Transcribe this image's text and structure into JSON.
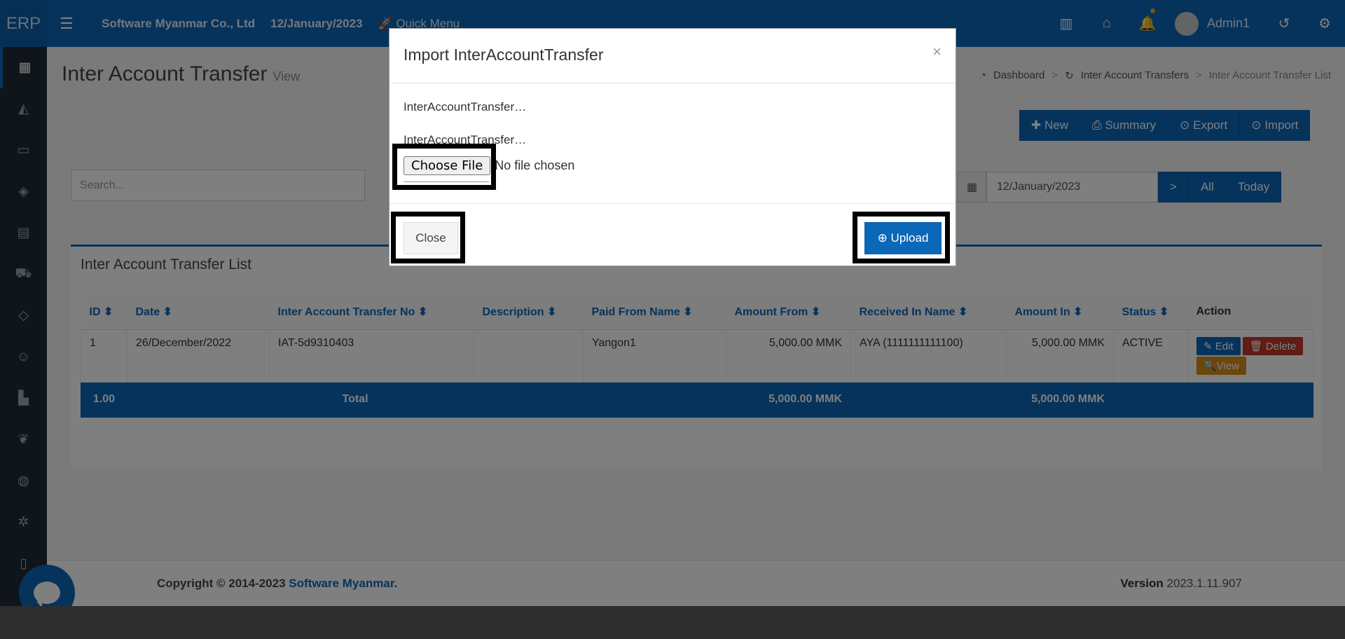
{
  "topbar": {
    "brand": "ERP",
    "company": "Software Myanmar Co., Ltd",
    "date": "12/January/2023",
    "quick_menu": "Quick Menu",
    "user_name": "Admin1"
  },
  "page": {
    "title": "Inter Account Transfer",
    "subtitle": "View",
    "breadcrumb": [
      "Dashboard",
      "Inter Account Transfers",
      "Inter Account Transfer List"
    ]
  },
  "toolbar": {
    "new_label": "New",
    "summary_label": "Summary",
    "export_label": "Export",
    "import_label": "Import"
  },
  "filters": {
    "search_placeholder": "Search...",
    "date_value": "12/January/2023",
    "next_label": ">",
    "all_label": "All",
    "today_label": "Today"
  },
  "list": {
    "title": "Inter Account Transfer List",
    "columns": [
      "ID",
      "Date",
      "Inter Account Transfer No",
      "Description",
      "Paid From Name",
      "Amount From",
      "Received In Name",
      "Amount In",
      "Status",
      "Action"
    ],
    "rows": [
      {
        "id": "1",
        "date": "26/December/2022",
        "no": "IAT-5d9310403",
        "description": "",
        "paid_from": "Yangon1",
        "amount_from": "5,000.00 MMK",
        "received_in": "AYA (1111111111100)",
        "amount_in": "5,000.00 MMK",
        "status": "ACTIVE"
      }
    ],
    "actions": {
      "edit": "Edit",
      "delete": "Delete",
      "view": "View"
    },
    "total": {
      "count": "1.00",
      "label": "Total",
      "amount_from": "5,000.00 MMK",
      "amount_in": "5,000.00 MMK"
    }
  },
  "footer": {
    "copyright": "Copyright © 2014-2023",
    "company_link": "Software Myanmar.",
    "version_label": "Version",
    "version": "2023.1.11.907"
  },
  "modal": {
    "title": "Import InterAccountTransfer",
    "close_x": "×",
    "field1_label": "InterAccountTransfer…",
    "field2_label": "InterAccountTransfer…",
    "choose_file_label": "Choose File",
    "no_file_label": "No file chosen",
    "close_button": "Close",
    "upload_button": "Upload"
  },
  "colors": {
    "primary": "#0b67b8",
    "danger": "#c0392b",
    "warning": "#d68f1a",
    "sidebar": "#1f2a35"
  }
}
